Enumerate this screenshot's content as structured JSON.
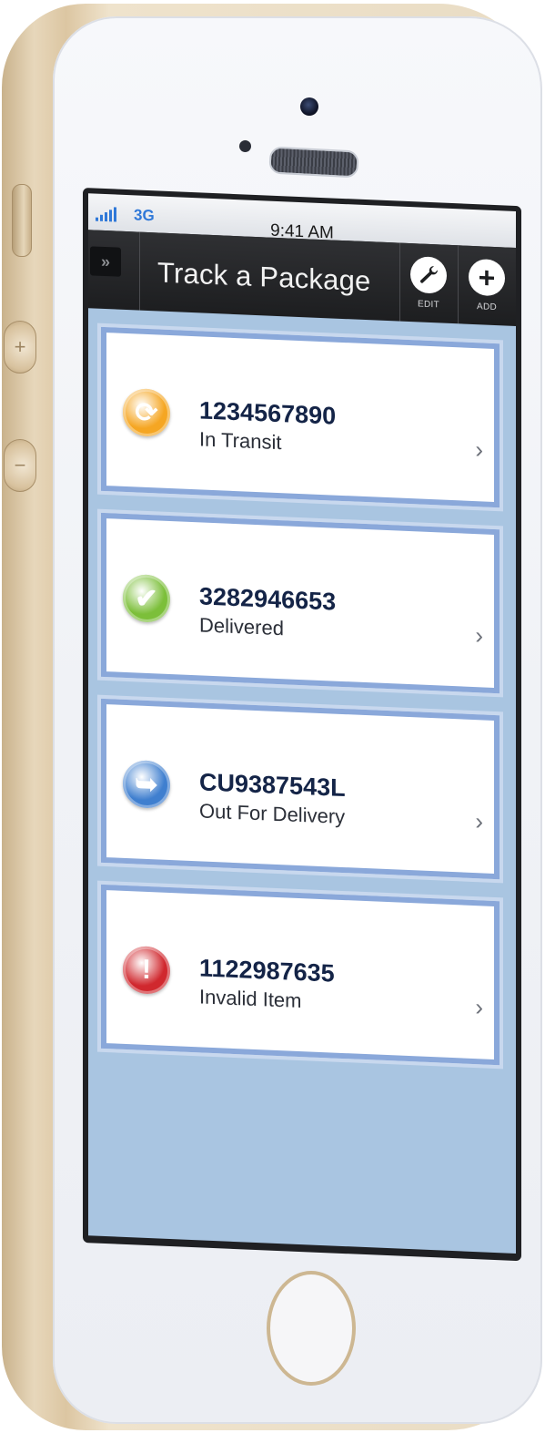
{
  "status_bar": {
    "network": "3G",
    "time": "9:41 AM"
  },
  "nav": {
    "menu_glyph": "»",
    "title": "Track a Package",
    "edit_label": "EDIT",
    "add_label": "ADD"
  },
  "packages": [
    {
      "number": "1234567890",
      "status": "In Transit",
      "icon": "refresh-icon",
      "color": "#f5a623"
    },
    {
      "number": "3282946653",
      "status": "Delivered",
      "icon": "checkmark-icon",
      "color": "#7cbf3a"
    },
    {
      "number": "CU9387543L",
      "status": "Out For Delivery",
      "icon": "arrow-icon",
      "color": "#3f7fcf"
    },
    {
      "number": "1122987635",
      "status": "Invalid Item",
      "icon": "exclamation-icon",
      "color": "#d0282e"
    }
  ]
}
